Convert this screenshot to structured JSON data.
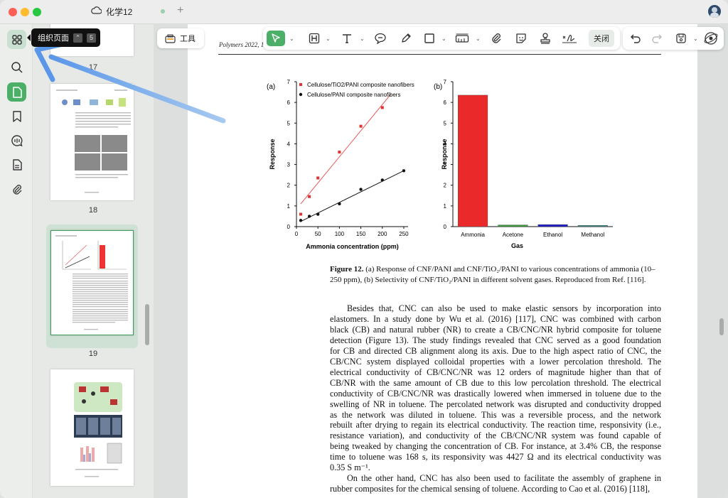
{
  "window": {
    "tab_title": "化学12",
    "tab_add": "+"
  },
  "tooltip": {
    "label": "组织页面",
    "key1": "⌃",
    "key2": "5"
  },
  "sidebar_thumbs": [
    {
      "number": "17"
    },
    {
      "number": "18"
    },
    {
      "number": "19"
    }
  ],
  "toolbar": {
    "tools_label": "工具",
    "close_label": "关闭"
  },
  "document": {
    "running_header": "Polymers 2022, 1",
    "figure_caption": {
      "label": "Figure 12.",
      "text": "(a) Response of CNF/PANI and CNF/TiO₂/PANI to various concentrations of ammonia (10–250 ppm), (b) Selectivity of CNF/TiO₂/PANI in different solvent gases. Reproduced from Ref. [116]."
    },
    "paragraphs": [
      [
        "Besides that, CNC can also be used to make elastic sensors by incorporation into",
        "elastomers. In a study done by Wu et al. (2016) [117], CNC was combined with carbon",
        "black (CB) and natural rubber (NR) to create a CB/CNC/NR hybrid composite for toluene",
        "detection (Figure 13). The study findings revealed that CNC served as a good foundation",
        "for CB and directed CB alignment along its axis. Due to the high aspect ratio of CNC, the",
        "CB/CNC system displayed colloidal properties with a lower percolation threshold. The",
        "electrical conductivity of CB/CNC/NR was 12 orders of magnitude higher than that of",
        "CB/NR with the same amount of CB due to this low percolation threshold. The electrical",
        "conductivity of CB/CNC/NR was drastically lowered when immersed in toluene due to the",
        "swelling of NR in toluene. The percolated network was disrupted and conductivity dropped",
        "as the network was diluted in toluene. This was a reversible process, and the network",
        "rebuilt after drying to regain its electrical conductivity. The reaction time, responsivity (i.e.,",
        "resistance variation), and conductivity of the CB/CNC/NR system was found capable of",
        "being tweaked by changing the concentration of CB. For instance, at 3.4% CB, the response",
        "time to toluene was 168 s, its responsivity was 4427 Ω and its electrical conductivity was",
        "0.35 S m⁻¹."
      ],
      [
        "On the other hand, CNC has also been used to facilitate the assembly of graphene in",
        "rubber composites for the chemical sensing of toluene. According to Cao et al. (2016) [118],"
      ]
    ]
  },
  "chart_data": [
    {
      "type": "scatter",
      "panel_label": "(a)",
      "xlabel": "Ammonia concentration (ppm)",
      "ylabel": "Response",
      "xlim": [
        0,
        260
      ],
      "ylim": [
        0,
        7
      ],
      "xticks": [
        "0",
        "50",
        "100",
        "150",
        "200",
        "250"
      ],
      "yticks": [
        "0",
        "1",
        "2",
        "3",
        "4",
        "5",
        "6",
        "7"
      ],
      "legend_position": "top-left",
      "series": [
        {
          "name": "Cellulose/TiO2/PANI composite nanofibers",
          "color": "#e03030",
          "x": [
            10,
            30,
            50,
            100,
            150,
            200
          ],
          "y": [
            0.6,
            1.45,
            2.35,
            3.6,
            4.85,
            5.75
          ],
          "fit": [
            [
              10,
              1.1
            ],
            [
              220,
              6.4
            ]
          ]
        },
        {
          "name": "Cellulose/PANI composite nanofibers",
          "color": "#111111",
          "x": [
            10,
            30,
            50,
            100,
            150,
            200,
            250
          ],
          "y": [
            0.3,
            0.5,
            0.6,
            1.1,
            1.8,
            2.25,
            2.7
          ],
          "fit": [
            [
              10,
              0.25
            ],
            [
              250,
              2.7
            ]
          ]
        }
      ]
    },
    {
      "type": "bar",
      "panel_label": "(b)",
      "xlabel": "Gas",
      "ylabel": "Response",
      "ylim": [
        0,
        7
      ],
      "yticks": [
        "0",
        "1",
        "2",
        "3",
        "4",
        "5",
        "6",
        "7"
      ],
      "categories": [
        "Ammonia",
        "Acetone",
        "Ethanol",
        "Methanol"
      ],
      "values": [
        6.35,
        0.08,
        0.1,
        0.06
      ],
      "colors": [
        "#ea2a2a",
        "#3d9d3d",
        "#1c1cc8",
        "#3a8a8a"
      ]
    }
  ]
}
